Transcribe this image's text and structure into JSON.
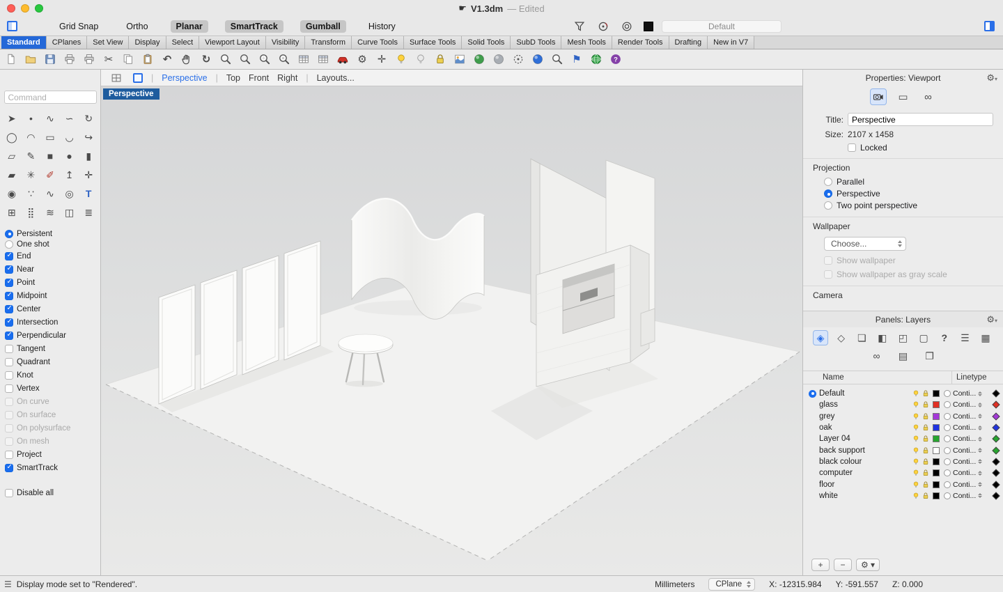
{
  "colors": {
    "accent": "#1a6dee",
    "active_tab_bg": "#2468d8",
    "viewport_badge_bg": "#1e5c9e"
  },
  "titlebar": {
    "title": "V1.3dm",
    "edited_suffix": "—  Edited"
  },
  "topbar": {
    "toggles": [
      {
        "label": "Grid Snap",
        "active": false
      },
      {
        "label": "Ortho",
        "active": false
      },
      {
        "label": "Planar",
        "active": true
      },
      {
        "label": "SmartTrack",
        "active": true
      },
      {
        "label": "Gumball",
        "active": true
      },
      {
        "label": "History",
        "active": false
      }
    ],
    "right_icons": [
      "selection-filter",
      "record-history",
      "gumball-menu"
    ],
    "display_mode_field": "Default"
  },
  "ribbon_tabs": {
    "active": "Standard",
    "tabs": [
      "Standard",
      "CPlanes",
      "Set View",
      "Display",
      "Select",
      "Viewport Layout",
      "Visibility",
      "Transform",
      "Curve Tools",
      "Surface Tools",
      "Solid Tools",
      "SubD Tools",
      "Mesh Tools",
      "Render Tools",
      "Drafting",
      "New in V7"
    ]
  },
  "toolbar_icons": [
    "new-file",
    "open-file",
    "save-file",
    "print",
    "print-preview",
    "cut",
    "copy-to-clipboard",
    "paste",
    "undo",
    "pan-view",
    "rotate-view",
    "zoom-dynamic",
    "zoom-window",
    "zoom-extents",
    "zoom-selected",
    "object-table",
    "layer-state",
    "car",
    "options-gear",
    "move-tool",
    "lamp-on",
    "lamp-off",
    "lock-toggle",
    "render-image",
    "render-preview-sphere",
    "shaded-sphere",
    "render-region",
    "raytrace-sphere",
    "zoom-lens",
    "drafting-flag",
    "earth-globe",
    "help"
  ],
  "sidebar": {
    "command_placeholder": "Command",
    "tool_icons": [
      "select",
      "single-point",
      "interpolate-curve",
      "control-point-curve",
      "circle-deform",
      "ellipse",
      "arc",
      "rectangle",
      "arc-blend",
      "curve-offset",
      "surface-plane",
      "sketch",
      "box",
      "sphere",
      "cylinder",
      "plane-tool",
      "explode",
      "freehand-sketch",
      "extrude",
      "cplane-axes",
      "metaball",
      "point-cloud",
      "sine-curve",
      "helix",
      "text-object",
      "array",
      "grid-array",
      "flow-along-curve",
      "cage-edit",
      "stairs"
    ],
    "osnap": {
      "modes": [
        {
          "label": "Persistent",
          "state": "on"
        },
        {
          "label": "One shot",
          "state": "off"
        }
      ],
      "snaps": [
        {
          "label": "End",
          "checked": true,
          "disabled": false
        },
        {
          "label": "Near",
          "checked": true,
          "disabled": false
        },
        {
          "label": "Point",
          "checked": true,
          "disabled": false
        },
        {
          "label": "Midpoint",
          "checked": true,
          "disabled": false
        },
        {
          "label": "Center",
          "checked": true,
          "disabled": false
        },
        {
          "label": "Intersection",
          "checked": true,
          "disabled": false
        },
        {
          "label": "Perpendicular",
          "checked": true,
          "disabled": false
        },
        {
          "label": "Tangent",
          "checked": false,
          "disabled": false
        },
        {
          "label": "Quadrant",
          "checked": false,
          "disabled": false
        },
        {
          "label": "Knot",
          "checked": false,
          "disabled": false
        },
        {
          "label": "Vertex",
          "checked": false,
          "disabled": false
        },
        {
          "label": "On curve",
          "checked": false,
          "disabled": true
        },
        {
          "label": "On surface",
          "checked": false,
          "disabled": true
        },
        {
          "label": "On polysurface",
          "checked": false,
          "disabled": true
        },
        {
          "label": "On mesh",
          "checked": false,
          "disabled": true
        },
        {
          "label": "Project",
          "checked": false,
          "disabled": false
        },
        {
          "label": "SmartTrack",
          "checked": true,
          "disabled": false
        }
      ],
      "disable_all": {
        "label": "Disable all",
        "checked": false
      }
    }
  },
  "viewport": {
    "active_badge": "Perspective",
    "tabs": [
      {
        "label": "Perspective",
        "active": true,
        "sep_before": true
      },
      {
        "label": "Top",
        "active": false,
        "sep_before": true
      },
      {
        "label": "Front",
        "active": false,
        "sep_before": false
      },
      {
        "label": "Right",
        "active": false,
        "sep_before": false
      },
      {
        "label": "Layouts...",
        "active": false,
        "sep_before": true
      }
    ]
  },
  "properties_panel": {
    "header": "Properties: Viewport",
    "tool_icons": [
      "camera",
      "display-rect",
      "chain-link"
    ],
    "fields": {
      "title_label": "Title:",
      "title_value": "Perspective",
      "size_label": "Size:",
      "size_value": "2107 x 1458",
      "locked_label": "Locked",
      "locked_checked": false
    },
    "projection": {
      "header": "Projection",
      "options": [
        {
          "label": "Parallel",
          "selected": false
        },
        {
          "label": "Perspective",
          "selected": true
        },
        {
          "label": "Two point perspective",
          "selected": false
        }
      ]
    },
    "wallpaper": {
      "header": "Wallpaper",
      "choose_label": "Choose...",
      "options": [
        {
          "label": "Show wallpaper",
          "checked": false,
          "disabled": true
        },
        {
          "label": "Show wallpaper as gray scale",
          "checked": false,
          "disabled": true
        }
      ]
    },
    "camera_header": "Camera"
  },
  "layers_panel": {
    "header": "Panels: Layers",
    "toolbar_icons_row1": [
      "layers-panel",
      "properties-panel",
      "notes-panel",
      "blocks-panel",
      "cplanes-panel",
      "display-panel",
      "help-panel",
      "commands-panel",
      "sheets-panel"
    ],
    "toolbar_icons_row2": [
      "chain-panel",
      "materials-panel",
      "folder-panel"
    ],
    "columns": {
      "name": "Name",
      "linetype": "Linetype"
    },
    "linetype_value": "Conti...",
    "layers": [
      {
        "name": "Default",
        "current": true,
        "color": "#000000",
        "diamond": "#000000"
      },
      {
        "name": "glass",
        "current": false,
        "color": "#e03024",
        "diamond": "#e03024"
      },
      {
        "name": "grey",
        "current": false,
        "color": "#a438d8",
        "diamond": "#a438d8"
      },
      {
        "name": "oak",
        "current": false,
        "color": "#2033e0",
        "diamond": "#2033e0"
      },
      {
        "name": "Layer 04",
        "current": false,
        "color": "#27a52f",
        "diamond": "#27a52f"
      },
      {
        "name": "back support",
        "current": false,
        "color": "#ffffff",
        "diamond": "#27a52f"
      },
      {
        "name": "black colour",
        "current": false,
        "color": "#000000",
        "diamond": "#000000"
      },
      {
        "name": "computer",
        "current": false,
        "color": "#000000",
        "diamond": "#000000"
      },
      {
        "name": "floor",
        "current": false,
        "color": "#000000",
        "diamond": "#000000"
      },
      {
        "name": "white",
        "current": false,
        "color": "#000000",
        "diamond": "#000000"
      }
    ],
    "footer": {
      "add": "+",
      "remove": "−"
    }
  },
  "statusbar": {
    "message": "Display mode set to \"Rendered\".",
    "units": "Millimeters",
    "cplane": "CPlane",
    "x": "X: -12315.984",
    "y": "Y: -591.557",
    "z": "Z: 0.000"
  }
}
